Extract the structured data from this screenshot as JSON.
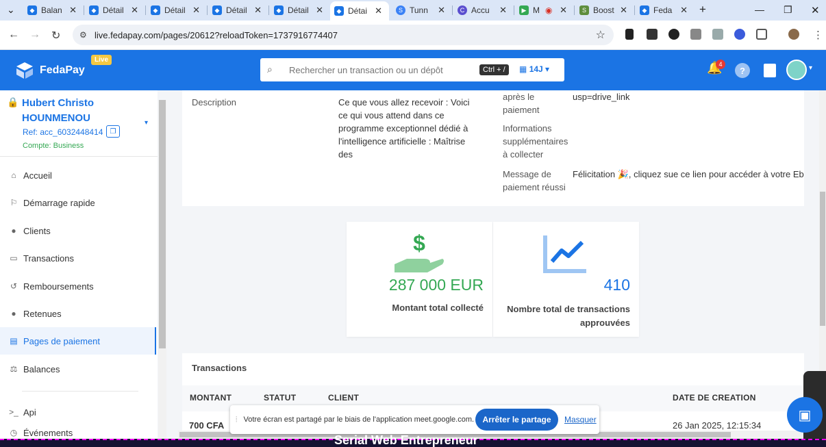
{
  "browser": {
    "tabs": [
      {
        "label": "Balan",
        "icon": "fedapay-icon"
      },
      {
        "label": "Détail",
        "icon": "fedapay-icon"
      },
      {
        "label": "Détail",
        "icon": "fedapay-icon"
      },
      {
        "label": "Détail",
        "icon": "fedapay-icon"
      },
      {
        "label": "Détail",
        "icon": "fedapay-icon"
      },
      {
        "label": "Détai",
        "icon": "fedapay-icon",
        "active": true
      },
      {
        "label": "Tunn",
        "icon": "s-icon"
      },
      {
        "label": "Accu",
        "icon": "c-icon"
      },
      {
        "label": "M",
        "icon": "meet-icon"
      },
      {
        "label": "Boost",
        "icon": "shopify-icon"
      },
      {
        "label": "Feda",
        "icon": "fedapay-icon"
      }
    ],
    "url": "live.fedapay.com/pages/20612?reloadToken=1737916774407"
  },
  "header": {
    "brand": "FedaPay",
    "live_badge": "Live",
    "search_placeholder": "Rechercher un transaction ou un dépôt",
    "shortcut": "Ctrl + /",
    "period": "14J",
    "notification_count": "4",
    "help": "?"
  },
  "account": {
    "name_line1": "Hubert Christo",
    "name_line2": "HOUNMENOU",
    "ref": "Ref: acc_6032448414",
    "type": "Compte: Business"
  },
  "sidebar": {
    "items": [
      {
        "label": "Accueil",
        "icon": "home-icon"
      },
      {
        "label": "Démarrage rapide",
        "icon": "flag-icon"
      },
      {
        "label": "Clients",
        "icon": "user-icon"
      },
      {
        "label": "Transactions",
        "icon": "money-icon"
      },
      {
        "label": "Remboursements",
        "icon": "refund-icon"
      },
      {
        "label": "Retenues",
        "icon": "hold-icon"
      },
      {
        "label": "Pages de paiement",
        "icon": "page-icon",
        "active": true
      },
      {
        "label": "Balances",
        "icon": "scale-icon"
      },
      {
        "label": "Api",
        "icon": "terminal-icon"
      },
      {
        "label": "Événements",
        "icon": "event-icon"
      }
    ]
  },
  "details": {
    "description_label": "Description",
    "description_lines": [
      "Ce que vous allez recevoir : Voici",
      "ce qui vous attend dans ce",
      "programme exceptionnel dédié à",
      "l'intelligence artificielle : Maîtrise",
      "des"
    ],
    "after_payment_lines": [
      "après le",
      "paiement"
    ],
    "after_payment_value": "usp=drive_link",
    "extra_info_lines": [
      "Informations",
      "supplémentaires",
      "à collecter"
    ],
    "message_label_lines": [
      "Message de",
      "paiement réussi"
    ],
    "message_value": "Félicitation 🎉, cliquez sue ce lien pour accéder à votre Ebo"
  },
  "stats": {
    "total_amount": "287 000 EUR",
    "total_amount_label": "Montant total collecté",
    "total_transactions": "410",
    "total_transactions_label_1": "Nombre total de transactions",
    "total_transactions_label_2": "approuvées"
  },
  "transactions": {
    "title": "Transactions",
    "columns": [
      "MONTANT",
      "STATUT",
      "CLIENT",
      "DATE DE CREATION"
    ],
    "rows": [
      {
        "amount": "700 CFA",
        "date": "26 Jan 2025, 12:15:34"
      }
    ]
  },
  "share_bar": {
    "message": "Votre écran est partagé par le biais de l'application meet.google.com.",
    "stop_button": "Arrêter le partage",
    "hide_link": "Masquer"
  },
  "banner_text": "Serial Web Entrepreneur",
  "colors": {
    "brand": "#1b74e4",
    "success": "#34a853",
    "chart_blue": "#5aa0ef"
  }
}
